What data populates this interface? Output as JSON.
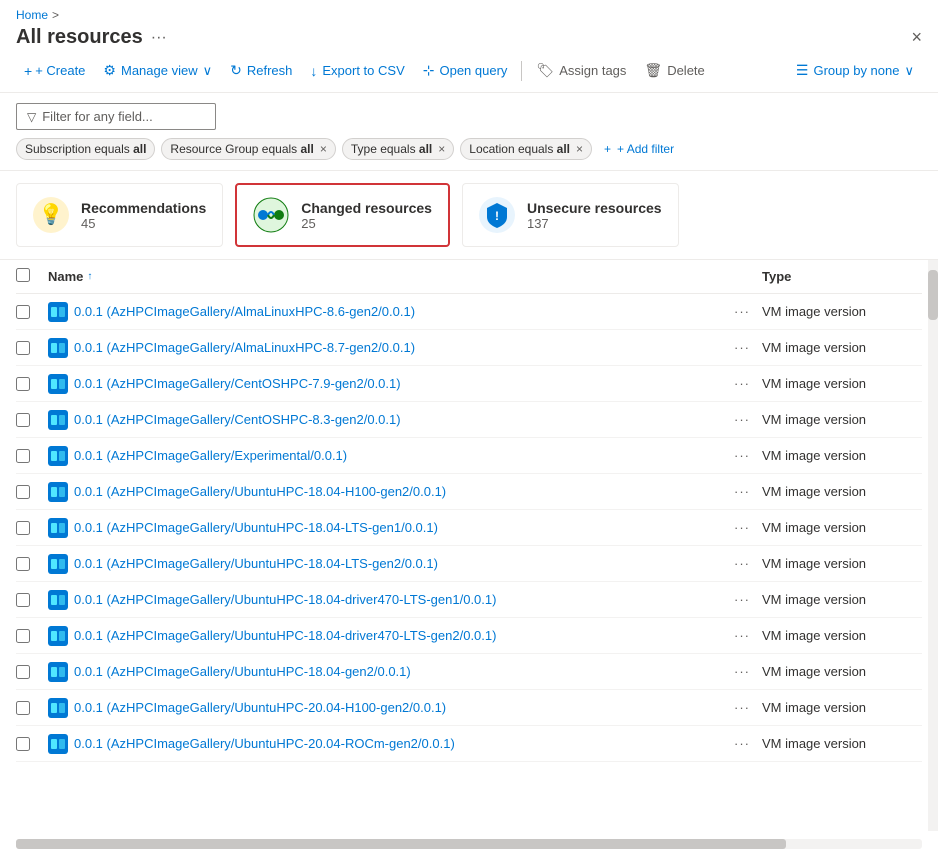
{
  "breadcrumb": {
    "home": "Home",
    "separator": ">"
  },
  "header": {
    "title": "All resources",
    "more_options": "···",
    "close": "×"
  },
  "toolbar": {
    "create": "+ Create",
    "manage_view": "Manage view",
    "manage_view_arrow": "∨",
    "refresh": "Refresh",
    "export_csv": "Export to CSV",
    "open_query": "Open query",
    "assign_tags": "Assign tags",
    "delete": "Delete",
    "group_by": "Group by none",
    "group_by_arrow": "∨"
  },
  "filter": {
    "placeholder": "Filter for any field...",
    "tags": [
      {
        "label": "Subscription equals",
        "bold": "all",
        "closable": false
      },
      {
        "label": "Resource Group equals",
        "bold": "all",
        "closable": true
      },
      {
        "label": "Type equals",
        "bold": "all",
        "closable": true
      },
      {
        "label": "Location equals",
        "bold": "all",
        "closable": true
      }
    ],
    "add_filter": "+ Add filter"
  },
  "cards": [
    {
      "id": "recommendations",
      "title": "Recommendations",
      "count": "45",
      "icon": "💡",
      "selected": false
    },
    {
      "id": "changed",
      "title": "Changed resources",
      "count": "25",
      "icon": "🔄",
      "selected": true
    },
    {
      "id": "unsecure",
      "title": "Unsecure resources",
      "count": "137",
      "icon": "🔒",
      "selected": false
    }
  ],
  "table": {
    "col_name": "Name",
    "sort_indicator": "↑",
    "col_type": "Type",
    "rows": [
      {
        "name": "0.0.1 (AzHPCImageGallery/AlmaLinuxHPC-8.6-gen2/0.0.1)",
        "type": "VM image version"
      },
      {
        "name": "0.0.1 (AzHPCImageGallery/AlmaLinuxHPC-8.7-gen2/0.0.1)",
        "type": "VM image version"
      },
      {
        "name": "0.0.1 (AzHPCImageGallery/CentOSHPC-7.9-gen2/0.0.1)",
        "type": "VM image version"
      },
      {
        "name": "0.0.1 (AzHPCImageGallery/CentOSHPC-8.3-gen2/0.0.1)",
        "type": "VM image version"
      },
      {
        "name": "0.0.1 (AzHPCImageGallery/Experimental/0.0.1)",
        "type": "VM image version"
      },
      {
        "name": "0.0.1 (AzHPCImageGallery/UbuntuHPC-18.04-H100-gen2/0.0.1)",
        "type": "VM image version"
      },
      {
        "name": "0.0.1 (AzHPCImageGallery/UbuntuHPC-18.04-LTS-gen1/0.0.1)",
        "type": "VM image version"
      },
      {
        "name": "0.0.1 (AzHPCImageGallery/UbuntuHPC-18.04-LTS-gen2/0.0.1)",
        "type": "VM image version"
      },
      {
        "name": "0.0.1 (AzHPCImageGallery/UbuntuHPC-18.04-driver470-LTS-gen1/0.0.1)",
        "type": "VM image version"
      },
      {
        "name": "0.0.1 (AzHPCImageGallery/UbuntuHPC-18.04-driver470-LTS-gen2/0.0.1)",
        "type": "VM image version"
      },
      {
        "name": "0.0.1 (AzHPCImageGallery/UbuntuHPC-18.04-gen2/0.0.1)",
        "type": "VM image version"
      },
      {
        "name": "0.0.1 (AzHPCImageGallery/UbuntuHPC-20.04-H100-gen2/0.0.1)",
        "type": "VM image version"
      },
      {
        "name": "0.0.1 (AzHPCImageGallery/UbuntuHPC-20.04-ROCm-gen2/0.0.1)",
        "type": "VM image version"
      }
    ]
  }
}
